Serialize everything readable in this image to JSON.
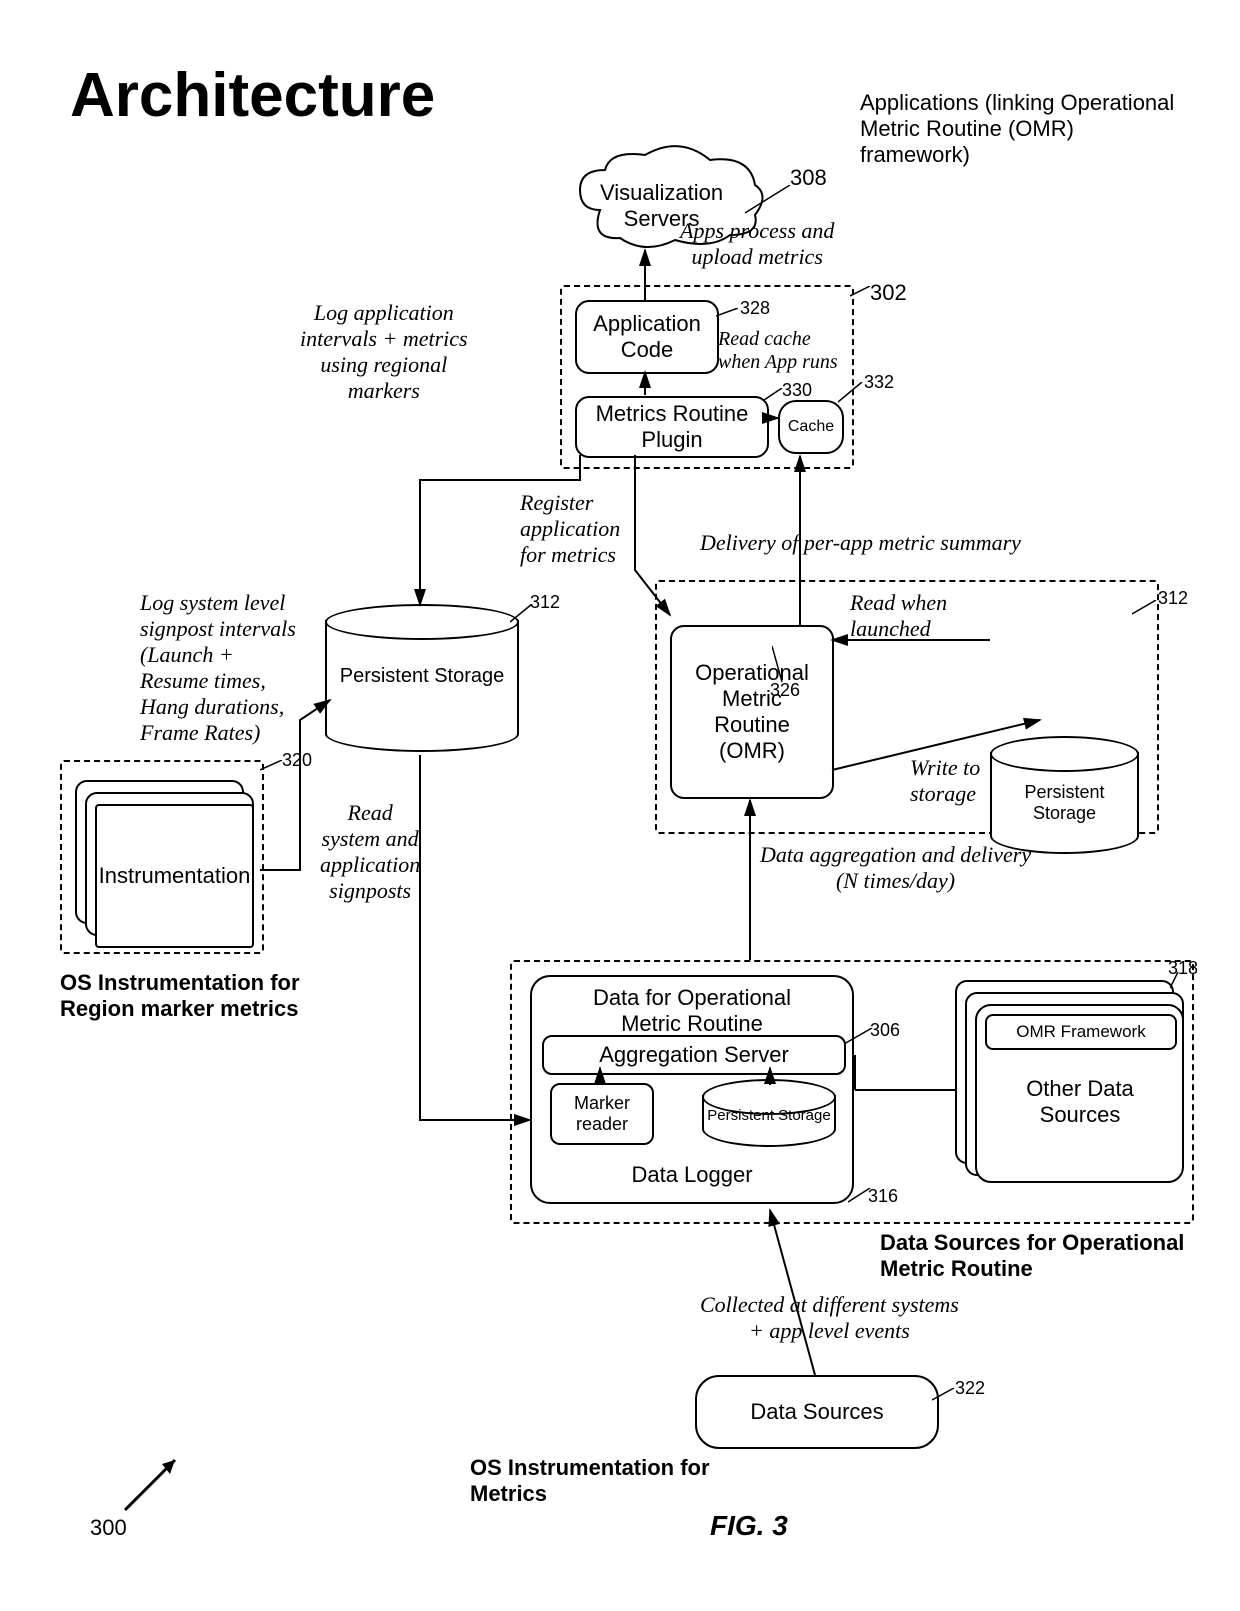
{
  "title": "Architecture",
  "fig_label": "FIG. 3",
  "ref_pointer": "300",
  "top_group_description": "Applications (linking Operational\nMetric Routine (OMR)\nframework)",
  "cloud": {
    "label": "Visualization\nServers"
  },
  "app_box": {
    "ref": "302",
    "app_code": "Application\nCode",
    "app_code_ref": "328",
    "plugin": "Metrics Routine\nPlugin",
    "plugin_ref": "330",
    "cache": "Cache",
    "cache_ref": "332",
    "cloud_note": "Apps process and\nupload metrics",
    "read_cache_note": "Read cache\nwhen App runs"
  },
  "left_notes": {
    "log_app": "Log application\nintervals + metrics\nusing regional\nmarkers",
    "log_sys": "Log system level\nsignpost intervals\n(Launch +\nResume times,\nHang durations,\nFrame Rates)",
    "read_signposts": "Read\nsystem and\napplication\nsignposts"
  },
  "register_note": "Register\napplication\nfor metrics",
  "persistent_storage_left": {
    "label": "Persistent\nStorage",
    "ref": "312"
  },
  "os_instr_region": {
    "box_label": "Instrumentation",
    "ref": "320",
    "caption": "OS Instrumentation for\nRegion marker metrics"
  },
  "delivery_group": {
    "read_when_launched": "Read when\nlaunched",
    "write_to_storage": "Write to\nstorage",
    "aggregation_note": "Data aggregation and delivery\n(N times/day)",
    "summary_note": "Delivery of per-app metric summary",
    "omr": {
      "label": "Operational\nMetric\nRoutine\n(OMR)",
      "ref": "326"
    },
    "persistent": {
      "label": "Persistent\nStorage",
      "ref": "312"
    }
  },
  "data_sources_group": {
    "ref_316": "316",
    "ref_306": "306",
    "ref_318": "318",
    "header": "Data for Operational\nMetric Routine",
    "agg_server": "Aggregation Server",
    "marker_reader": "Marker\nreader",
    "pers_storage": "Persistent\nStorage",
    "data_logger": "Data Logger",
    "framework_top": "OMR Framework",
    "framework_bottom": "Other Data\nSources",
    "caption": "Data Sources for Operational\nMetric Routine",
    "collected_note": "Collected at different systems\n+ app level events"
  },
  "bottom": {
    "data_sources": "Data Sources",
    "ref": "322",
    "caption": "OS Instrumentation for\nMetrics"
  },
  "cloud_ref": "308"
}
